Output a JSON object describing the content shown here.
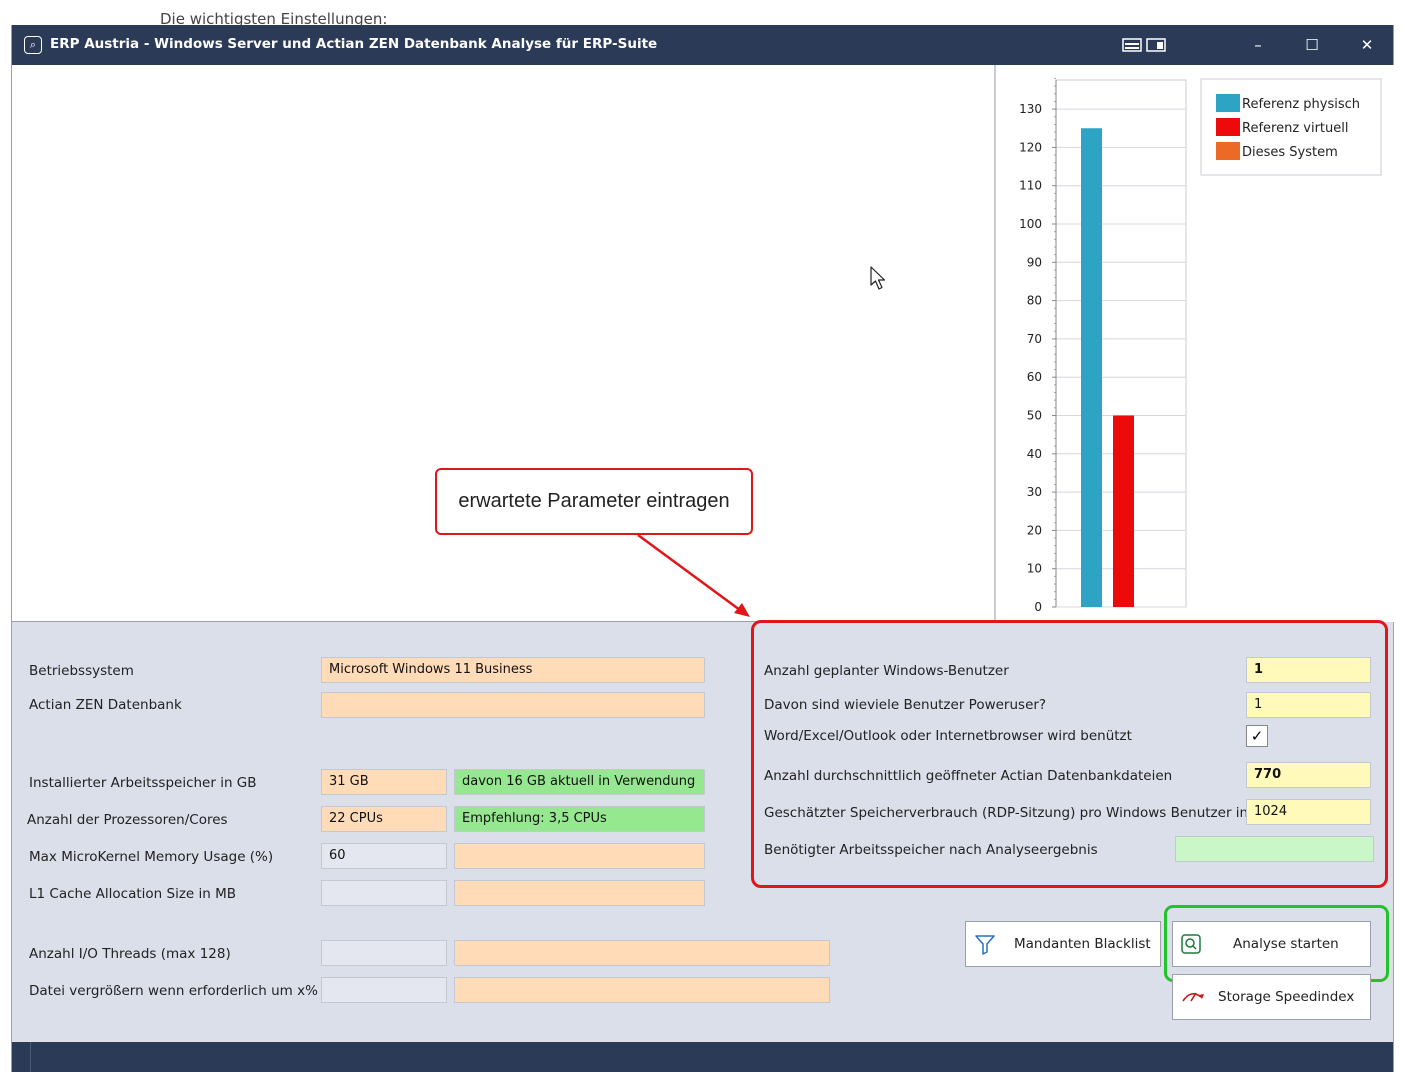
{
  "background_peek_text": "Die wichtigsten Einstellungen:",
  "window": {
    "title": "ERP Austria - Windows Server und Actian ZEN Datenbank Analyse für ERP-Suite",
    "controls": {
      "minimize": "–",
      "maximize": "☐",
      "close": "✕"
    }
  },
  "callout": {
    "text": "erwartete Parameter eintragen"
  },
  "chart_data": {
    "type": "bar",
    "categories": [
      ""
    ],
    "series": [
      {
        "name": "Referenz physisch",
        "values": [
          125
        ],
        "color": "#2ea4c4"
      },
      {
        "name": "Referenz virtuell",
        "values": [
          50
        ],
        "color": "#ec0a0a"
      },
      {
        "name": "Dieses System",
        "values": [
          0
        ],
        "color": "#ec6a26"
      }
    ],
    "ylim": [
      0,
      135
    ],
    "yticks": [
      0,
      10,
      20,
      30,
      40,
      50,
      60,
      70,
      80,
      90,
      100,
      110,
      120,
      130
    ],
    "legend_position": "top-right",
    "grid": true
  },
  "left_form": {
    "betriebssystem_label": "Betriebssystem",
    "betriebssystem_value": "Microsoft Windows 11 Business",
    "actian_label": "Actian ZEN Datenbank",
    "actian_value": "",
    "ram_label": "Installierter Arbeitsspeicher in GB",
    "ram_value": "31 GB",
    "ram_info": "davon 16 GB aktuell in Verwendung",
    "cpu_label": "Anzahl der Prozessoren/Cores",
    "cpu_value": "22 CPUs",
    "cpu_info": "Empfehlung: 3,5 CPUs",
    "mkmem_label": "Max MicroKernel Memory Usage  (%)",
    "mkmem_value": "60",
    "mkmem_info": "",
    "l1_label": "L1 Cache Allocation Size in MB",
    "l1_value": "",
    "l1_info": "",
    "io_label": "Anzahl I/O Threads (max 128)",
    "io_value": "",
    "io_info": "",
    "grow_label": "Datei vergrößern wenn erforderlich um x%",
    "grow_value": "",
    "grow_info": ""
  },
  "right_form": {
    "users_label": "Anzahl geplanter Windows-Benutzer",
    "users_value": "1",
    "power_label": "Davon sind wieviele Benutzer Poweruser?",
    "power_value": "1",
    "office_label": "Word/Excel/Outlook oder Internetbrowser wird benützt",
    "office_checked": "✓",
    "dbfiles_label": "Anzahl durchschnittlich geöffneter Actian Datenbankdateien",
    "dbfiles_value": "770",
    "mem_label": "Geschätzter Speicherverbrauch (RDP-Sitzung) pro Windows Benutzer in MB",
    "mem_value": "1024",
    "result_label": "Benötigter Arbeitsspeicher nach Analyseergebnis",
    "result_value": ""
  },
  "buttons": {
    "blacklist": "Mandanten Blacklist",
    "analyse": "Analyse starten",
    "speedindex": "Storage Speedindex"
  },
  "colors": {
    "titlebar": "#2b3a57",
    "highlight_red": "#e0161a",
    "highlight_green": "#22c32b",
    "peach_field": "#ffdbb8",
    "green_field": "#96e890",
    "yellow_field": "#fffaba"
  }
}
